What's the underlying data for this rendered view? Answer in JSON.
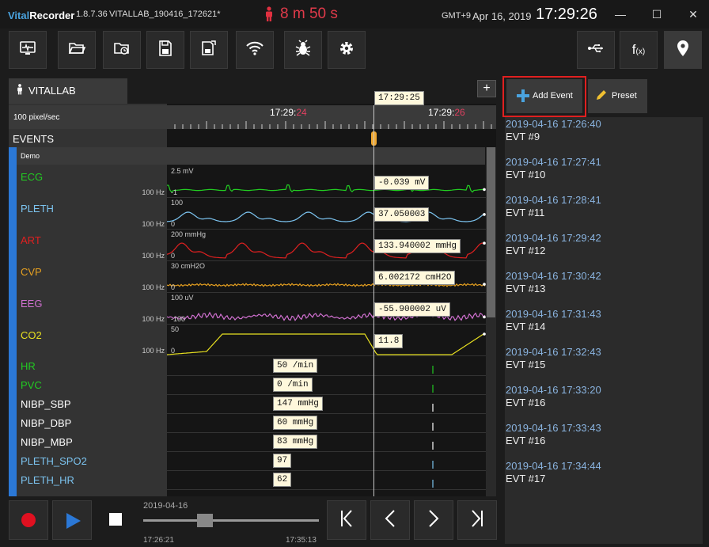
{
  "app": {
    "brand_a": "Vital",
    "brand_b": "Recorder",
    "version": "1.8.7.36",
    "file": "VITALLAB_190416_172621*"
  },
  "recording_time": "8 m 50 s",
  "clock": {
    "timezone": "GMT+9",
    "date": "Apr 16, 2019",
    "time": "17:29:26"
  },
  "window_controls": [
    "—",
    "☐",
    "✕"
  ],
  "toolbar": {
    "left_icons": [
      "monitor-icon",
      "folder-open-icon",
      "folder-clock-icon",
      "save-icon",
      "save-as-icon",
      "wifi-icon",
      "bug-icon",
      "gear-icon"
    ],
    "right_icons": [
      "usb-icon",
      "function-icon",
      "location-pin-icon"
    ],
    "fx_label": "f",
    "fx_sub": "(x)"
  },
  "tab": {
    "label": "VITALLAB",
    "add_label": "+"
  },
  "timeline": {
    "speed": "100 pixel/sec",
    "cursor_time": "17:29:25",
    "ticks": [
      {
        "prefix": "17:29:",
        "sec": "24"
      },
      {
        "prefix": "17:29:",
        "sec": "26"
      }
    ]
  },
  "events_row": "EVENTS",
  "group_label": "Demo",
  "tracks": [
    {
      "name": "ECG",
      "color": "#22cc22",
      "scale_top": "2.5 mV",
      "scale_bottom": "-1",
      "hz": "100 Hz",
      "value": "-0.039 mV"
    },
    {
      "name": "PLETH",
      "color": "#7cc4f0",
      "scale_top": "100",
      "scale_bottom": "0",
      "hz": "100 Hz",
      "value": "37.050003"
    },
    {
      "name": "ART",
      "color": "#e02020",
      "scale_top": "200 mmHg",
      "scale_bottom": "0",
      "hz": "100 Hz",
      "value": "133.940002 mmHg"
    },
    {
      "name": "CVP",
      "color": "#e6a020",
      "scale_top": "30 cmH2O",
      "scale_bottom": "0",
      "hz": "100 Hz",
      "value": "6.002172 cmH2O"
    },
    {
      "name": "EEG",
      "color": "#d070d0",
      "scale_top": "100 uV",
      "scale_bottom": "-100",
      "hz": "100 Hz",
      "value": "-55.900002 uV"
    },
    {
      "name": "CO2",
      "color": "#e8e020",
      "scale_top": "50",
      "scale_bottom": "0",
      "hz": "100 Hz",
      "value": "11.8"
    }
  ],
  "numerics": [
    {
      "name": "HR",
      "color": "#22cc22",
      "value": "50 /min"
    },
    {
      "name": "PVC",
      "color": "#22cc22",
      "value": "0 /min"
    },
    {
      "name": "NIBP_SBP",
      "color": "#ffffff",
      "value": "147 mmHg"
    },
    {
      "name": "NIBP_DBP",
      "color": "#ffffff",
      "value": "60 mmHg"
    },
    {
      "name": "NIBP_MBP",
      "color": "#ffffff",
      "value": "83 mmHg"
    },
    {
      "name": "PLETH_SPO2",
      "color": "#7cc4f0",
      "value": "97"
    },
    {
      "name": "PLETH_HR",
      "color": "#7cc4f0",
      "value": "62"
    }
  ],
  "buttons": {
    "add_event": "Add Event",
    "preset": "Preset"
  },
  "events": [
    {
      "time": "2019-04-16 17:26:40",
      "name": "EVT #9"
    },
    {
      "time": "2019-04-16 17:27:41",
      "name": "EVT #10"
    },
    {
      "time": "2019-04-16 17:28:41",
      "name": "EVT #11"
    },
    {
      "time": "2019-04-16 17:29:42",
      "name": "EVT #12"
    },
    {
      "time": "2019-04-16 17:30:42",
      "name": "EVT #13"
    },
    {
      "time": "2019-04-16 17:31:43",
      "name": "EVT #14"
    },
    {
      "time": "2019-04-16 17:32:43",
      "name": "EVT #15"
    },
    {
      "time": "2019-04-16 17:33:20",
      "name": "EVT #16"
    },
    {
      "time": "2019-04-16 17:33:43",
      "name": "EVT #16"
    },
    {
      "time": "2019-04-16 17:34:44",
      "name": "EVT #17"
    }
  ],
  "playback": {
    "date": "2019-04-16",
    "start": "17:26:21",
    "end": "17:35:13",
    "position_fraction": 0.35
  },
  "colors": {
    "accent_red": "#e03030",
    "link_blue": "#8ab4e0",
    "highlight": "#e02020"
  }
}
